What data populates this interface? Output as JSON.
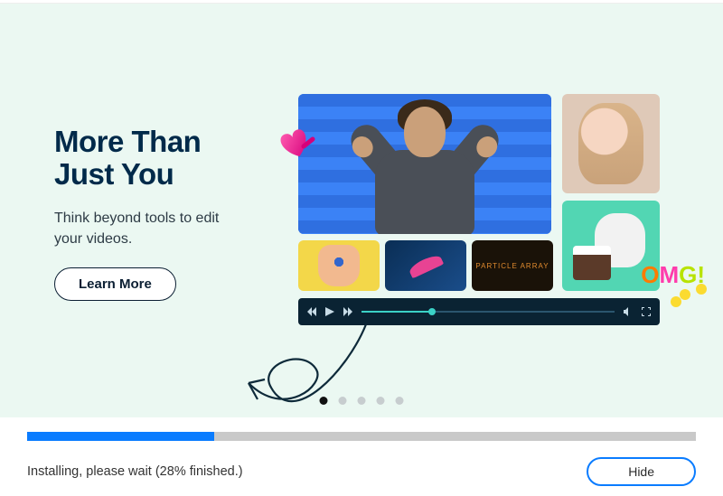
{
  "hero": {
    "title_line1": "More Than",
    "title_line2": "Just You",
    "subtitle": "Think beyond tools to edit your videos.",
    "learn_more_label": "Learn More"
  },
  "gallery": {
    "fx_label": "PARTICLE ARRAY",
    "playbar_progress_pct": 28
  },
  "carousel": {
    "count": 5,
    "active_index": 0
  },
  "installer": {
    "progress_pct": 28,
    "status_text": "Installing, please wait (28% finished.)",
    "hide_label": "Hide"
  },
  "colors": {
    "hero_bg": "#ebf8f2",
    "accent": "#0a7cff",
    "title": "#012a4a"
  }
}
